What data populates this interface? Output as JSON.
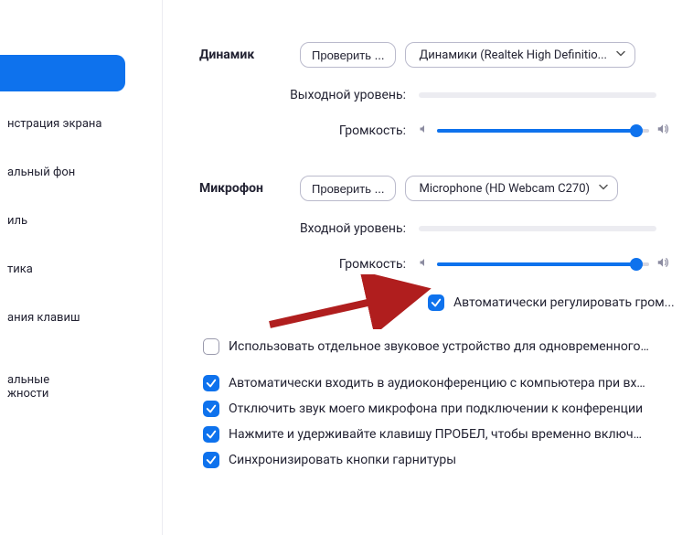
{
  "sidebar": {
    "items": [
      {
        "label": "",
        "active": true
      },
      {
        "label": "нстрация экрана"
      },
      {
        "label": "альный фон"
      },
      {
        "label": "иль"
      },
      {
        "label": "тика"
      },
      {
        "label": "ания клавиш"
      },
      {
        "label": "альные\nжности"
      }
    ]
  },
  "speaker": {
    "section_label": "Динамик",
    "test_button": "Проверить ...",
    "device": "Динамики (Realtek High Definitio...",
    "output_level_label": "Выходной уровень:",
    "volume_label": "Громкость:",
    "volume_percent": 94
  },
  "microphone": {
    "section_label": "Микрофон",
    "test_button": "Проверить ...",
    "device": "Microphone (HD Webcam C270)",
    "input_level_label": "Входной уровень:",
    "volume_label": "Громкость:",
    "volume_percent": 94,
    "auto_adjust_label": "Автоматически регулировать гром...",
    "auto_adjust_checked": true
  },
  "options": {
    "separate_device": {
      "label": "Использовать отдельное звуковое устройство для одновременного воспро...",
      "checked": false
    },
    "auto_join_audio": {
      "label": "Автоматически входить в аудиоконференцию с компьютера при входе в кон...",
      "checked": true
    },
    "mute_on_join": {
      "label": "Отключить звук моего микрофона при подключении к конференции",
      "checked": true
    },
    "hold_space_unmute": {
      "label": "Нажмите и удерживайте клавишу ПРОБЕЛ, чтобы временно включить свой з...",
      "checked": true
    },
    "sync_headset_buttons": {
      "label": "Синхронизировать кнопки гарнитуры",
      "checked": true
    }
  },
  "colors": {
    "accent": "#0e72ed",
    "arrow": "#b01e1e"
  }
}
